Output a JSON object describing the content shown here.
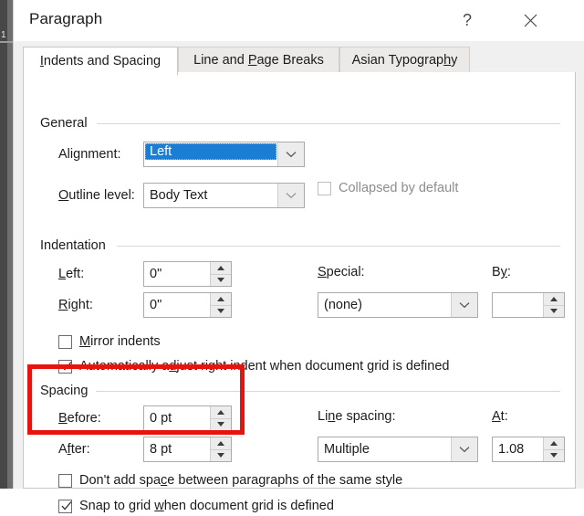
{
  "window": {
    "title": "Paragraph",
    "help_icon": "question-mark-icon",
    "close_icon": "close-x-icon"
  },
  "background": {
    "page_number": "1"
  },
  "tabs": [
    {
      "label": "Indents and Spacing",
      "accel": "I",
      "selected": true
    },
    {
      "label": "Line and Page Breaks",
      "accel": "P",
      "selected": false
    },
    {
      "label": "Asian Typography",
      "accel": "h",
      "selected": false
    }
  ],
  "groups": {
    "general": "General",
    "indentation": "Indentation",
    "spacing": "Spacing"
  },
  "general": {
    "alignment_label": "Alignment:",
    "alignment_value": "Left",
    "alignment_selected": true,
    "outline_label": "Outline level:",
    "outline_value": "Body Text",
    "collapsed_label": "Collapsed by default",
    "collapsed_checked": false,
    "collapsed_disabled": true
  },
  "indentation": {
    "left_label": "Left:",
    "left_value": "0\"",
    "right_label": "Right:",
    "right_value": "0\"",
    "special_label": "Special:",
    "special_value": "(none)",
    "by_label": "By:",
    "by_value": "",
    "mirror_label": "Mirror indents",
    "mirror_checked": false,
    "autoadjust_label": "Automatically adjust right indent when document grid is defined",
    "autoadjust_checked": true
  },
  "spacing": {
    "before_label": "Before:",
    "before_value": "0 pt",
    "after_label": "After:",
    "after_value": "8 pt",
    "linespacing_label": "Line spacing:",
    "linespacing_value": "Multiple",
    "at_label": "At:",
    "at_value": "1.08",
    "dontadd_label": "Don't add space between paragraphs of the same style",
    "dontadd_checked": false,
    "snaptogrid_label": "Snap to grid when document grid is defined",
    "snaptogrid_checked": true
  },
  "annotation": {
    "color": "#e8120f",
    "shape": "rectangle-highlight"
  },
  "colors": {
    "selection_blue": "#1a7fd4",
    "dialog_background": "#f0f0f0",
    "panel_white": "#ffffff",
    "annotation_red": "#e8120f"
  }
}
